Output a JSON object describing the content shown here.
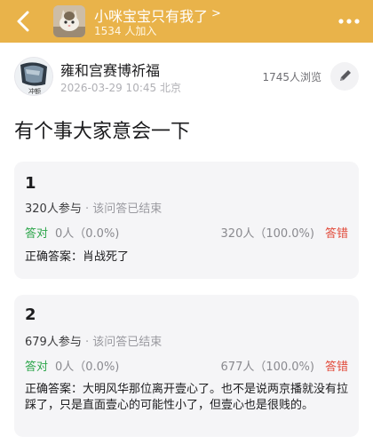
{
  "colors": {
    "header": "#e9b34a",
    "correct": "#2ca54a",
    "wrong": "#e14a3a"
  },
  "header": {
    "group_name": "小咪宝宝只有我了",
    "chevron": ">",
    "member_count": "1534 人加入",
    "avatar_icon": "group-avatar-cat",
    "back_icon": "chevron-left-icon",
    "more_icon": "more-dots-icon"
  },
  "post": {
    "author": "雍和宫赛博祈福",
    "avatar_caption": "冲额",
    "datetime": "2026-03-29 10:45",
    "location": "北京",
    "views": "1745人浏览",
    "title": "有个事大家意会一下"
  },
  "quizzes": [
    {
      "number": "1",
      "participants": "320人参与",
      "sep": "·",
      "status": "该问答已结束",
      "correct_label": "答对",
      "correct_stat": "0人（0.0%)",
      "wrong_stat": "320人（100.0%)",
      "wrong_label": "答错",
      "answer": "正确答案：肖战死了"
    },
    {
      "number": "2",
      "participants": "679人参与",
      "sep": "·",
      "status": "该问答已结束",
      "correct_label": "答对",
      "correct_stat": "0人（0.0%)",
      "wrong_stat": "677人（100.0%)",
      "wrong_label": "答错",
      "answer": "正确答案：大明风华那位离开壹心了。也不是说两京播就没有拉踩了，只是直面壹心的可能性小了，但壹心也是很贱的。"
    }
  ]
}
